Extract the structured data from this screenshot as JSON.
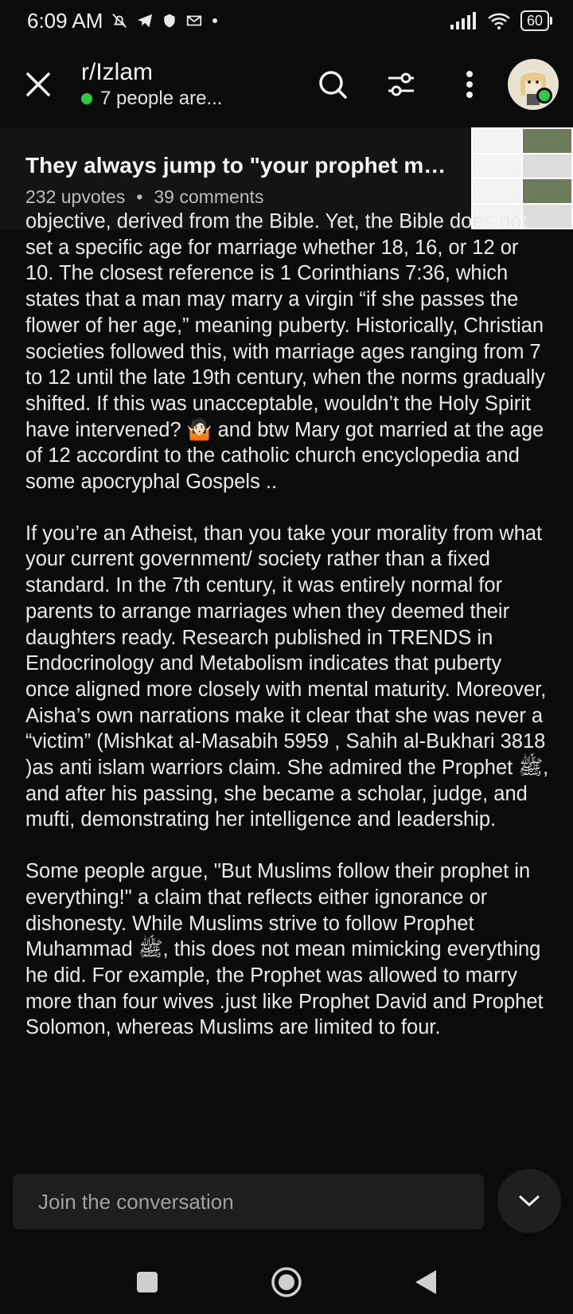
{
  "status_bar": {
    "time": "6:09 AM",
    "notification_icons": [
      "bell-off-icon",
      "telegram-icon",
      "shield-icon",
      "mail-icon",
      "dot-icon"
    ],
    "battery": "60"
  },
  "app_bar": {
    "subreddit": "r/Izlam",
    "online_text": "7 people are..."
  },
  "post": {
    "title": "They always jump to \"your prophet marri...",
    "upvotes": "232 upvotes",
    "separator": "•",
    "comments": "39 comments"
  },
  "content": {
    "paragraphs": [
      "objective, derived from the Bible. Yet, the Bible does not set a specific age for marriage whether 18, 16, or 12 or 10. The closest reference is 1 Corinthians 7:36, which states that a man may marry a virgin “if she passes the flower of her age,” meaning puberty. Historically, Christian societies followed this, with marriage ages ranging from 7 to 12 until the late 19th century, when the norms gradually shifted. If this was unacceptable, wouldn’t the Holy Spirit have intervened? 🤷🏻 and btw Mary got married at the age of 12 accordint to the catholic church encyclopedia and some apocryphal Gospels ..",
      "If you’re an Atheist, than you take your morality from what your current government/ society rather than a fixed standard. In the 7th century, it was entirely normal for parents to arrange marriages when they deemed their daughters ready. Research published in TRENDS in Endocrinology and Metabolism indicates that puberty once aligned more closely with mental maturity. Moreover, Aisha’s own narrations make it clear that she was never a “victim” (Mishkat al-Masabih 5959 , Sahih al-Bukhari 3818 )as anti islam warriors claim. She admired the Prophet ﷺ, and after his passing, she became a scholar, judge, and mufti, demonstrating her intelligence and leadership.",
      "Some people argue, \"But Muslims follow their prophet in everything!\" a claim that reflects either ignorance or dishonesty. While Muslims strive to follow Prophet Muhammad ﷺ, this does not mean mimicking everything he did. For example, the Prophet was allowed to marry more than four wives .just like Prophet David and Prophet Solomon, whereas Muslims are limited to four."
    ]
  },
  "composer": {
    "placeholder": "Join the conversation"
  },
  "colors": {
    "background": "#0b0b0b",
    "header_bg": "#141414",
    "online": "#2ecc40",
    "text": "#eaeaea"
  }
}
